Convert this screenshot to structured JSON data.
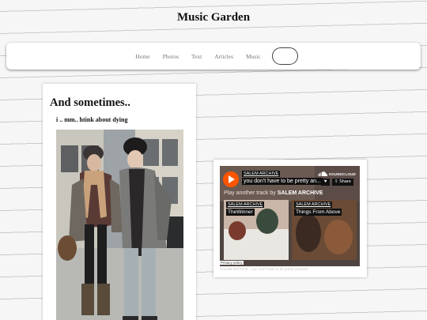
{
  "site": {
    "title": "Music Garden"
  },
  "nav": {
    "items": [
      {
        "label": "Home"
      },
      {
        "label": "Photos"
      },
      {
        "label": "Text"
      },
      {
        "label": "Articles"
      },
      {
        "label": "Music"
      }
    ]
  },
  "post": {
    "title": "And sometimes..",
    "subtitle": "i .. mm.. htink about dying"
  },
  "soundcloud": {
    "artist": "SALEM ARCHIVE",
    "track": "you don't have to be pretty an...",
    "brand": "SOUNDCLOUD",
    "share_label": "Share",
    "play_another_prefix": "Play another track by",
    "play_another_artist": "SALEM ARCHIVE",
    "recommendations": [
      {
        "artist": "SALEM ARCHIVE",
        "track": "TheWinner"
      },
      {
        "artist": "SALEM ARCHIVE",
        "track": "Things From Above"
      }
    ],
    "privacy": "Privacy policy",
    "footer": "SALEM ARCHIVE · you don't have to be pretty anymore",
    "accent": "#ff5500"
  }
}
